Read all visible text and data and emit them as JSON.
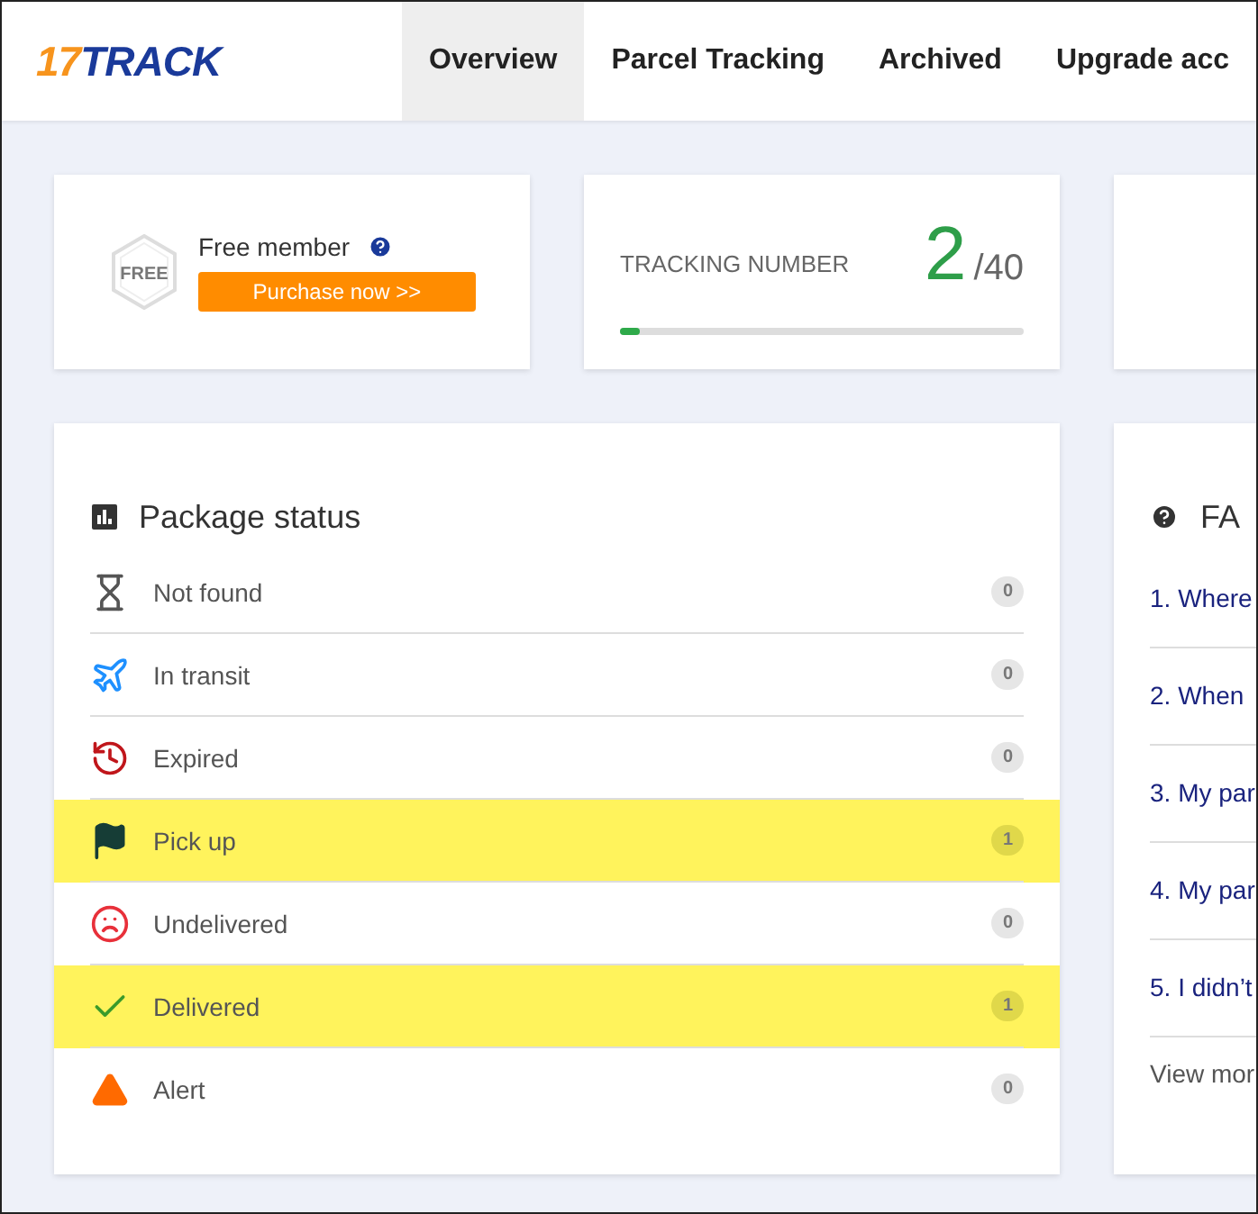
{
  "header": {
    "logo": {
      "digits": "17",
      "word": "TRACK"
    },
    "tabs": [
      {
        "label": "Overview",
        "selected": true
      },
      {
        "label": "Parcel Tracking",
        "selected": false
      },
      {
        "label": "Archived",
        "selected": false
      },
      {
        "label": "Upgrade acc",
        "selected": false
      }
    ]
  },
  "member_card": {
    "badge": "FREE",
    "title": "Free member",
    "button": "Purchase now >>"
  },
  "tracking_card": {
    "label": "TRACKING NUMBER",
    "count": "2",
    "limit": "/40",
    "level": 0.05
  },
  "package_status": {
    "title": "Package status",
    "rows": [
      {
        "kind": "notfound",
        "label": "Not found",
        "count": "0",
        "highlighted": false
      },
      {
        "kind": "transit",
        "label": "In transit",
        "count": "0",
        "highlighted": false
      },
      {
        "kind": "expired",
        "label": "Expired",
        "count": "0",
        "highlighted": false
      },
      {
        "kind": "pickup",
        "label": "Pick up",
        "count": "1",
        "highlighted": true
      },
      {
        "kind": "undelivered",
        "label": "Undelivered",
        "count": "0",
        "highlighted": false
      },
      {
        "kind": "delivered",
        "label": "Delivered",
        "count": "1",
        "highlighted": true
      },
      {
        "kind": "alert",
        "label": "Alert",
        "count": "0",
        "highlighted": false
      }
    ]
  },
  "faq": {
    "title": "FA",
    "items": [
      "1. Where",
      "2. When",
      "3. My par",
      "4. My par",
      "5. I didn’t"
    ],
    "more": "View mor"
  }
}
